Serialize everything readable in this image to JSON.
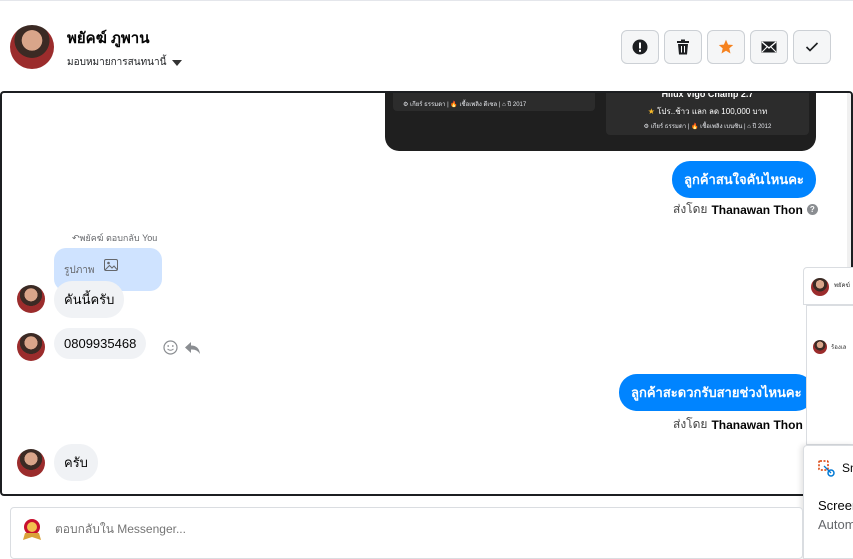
{
  "header": {
    "name": "พยัคฆ์ ภูพาน",
    "assign_label": "มอบหมายการสนทนานี้",
    "buttons": [
      "report-icon",
      "trash-icon",
      "star-icon",
      "mail-icon",
      "check-icon"
    ],
    "colors": {
      "star": "#f5821f",
      "border": "#ccd0d5"
    }
  },
  "preview_card": {
    "left_meta": "⚙ เกียร์ ธรรมดา | 🔥 เชื้อเพลิง ดีเซล | ⌂ ปี 2017",
    "title": "Hilux Vigo Champ 2.7",
    "subtitle": "โปร..ช้าว แลก ลด 100,000 บาท",
    "meta": "⚙ เกียร์ ธรรมดา | 🔥 เชื้อเพลิง เบนซิน | ⌂ ปี 2012"
  },
  "messages": {
    "out1": "ลูกค้าสนใจคันไหนคะ",
    "sent_by_1_prefix": "ส่งโดย",
    "sent_by_1_name": "Thanawan Thon",
    "reply_note": "พยัคฆ์ ตอบกลับ You",
    "reply_quote": "รูปภาพ",
    "in1": "คันนี้ครับ",
    "in2": "0809935468",
    "out2": "ลูกค้าสะดวกรับสายช่วงไหนคะ",
    "sent_by_2_prefix": "ส่งโดย",
    "sent_by_2_name": "Thanawan Thon",
    "in3": "ครับ"
  },
  "side_panel": {
    "top_text": "พยัคฆ์",
    "mid_text": "ร้องเล",
    "sn_label": "Sn",
    "screen_label": "Screen",
    "auto_label": "Autom"
  },
  "composer": {
    "placeholder": "ตอบกลับใน Messenger..."
  },
  "colors": {
    "outgoing_bubble": "#0084ff",
    "incoming_bubble": "#f0f2f5",
    "reply_bubble": "#cfe3ff"
  }
}
